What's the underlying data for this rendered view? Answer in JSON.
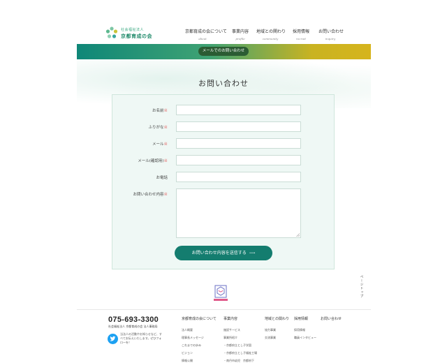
{
  "header": {
    "logo_sub": "社会福祉法人",
    "logo_main": "京都育成の会",
    "nav": [
      {
        "jp": "京都育成の会について",
        "en": "about"
      },
      {
        "jp": "事業内容",
        "en": "profile"
      },
      {
        "jp": "地域との関わり",
        "en": "community"
      },
      {
        "jp": "採用情報",
        "en": "recruit"
      },
      {
        "jp": "お問い合わせ",
        "en": "inquiry"
      }
    ]
  },
  "banner": {
    "button_label": "メールでのお問い合わせ"
  },
  "page_title": "お問い合わせ",
  "form": {
    "fields": [
      {
        "label": "お名前",
        "required": "※"
      },
      {
        "label": "ふりがな",
        "required": "※"
      },
      {
        "label": "メール",
        "required": "※"
      },
      {
        "label": "メール(確認用)",
        "required": "※"
      },
      {
        "label": "お電話",
        "required": ""
      }
    ],
    "message_label": "お問い合わせ内容",
    "message_required": "※",
    "submit_label": "お問い合わせ内容を送信する",
    "submit_arrow": "⟶"
  },
  "page_top": "ページトップ",
  "footer": {
    "phone": "075-693-3300",
    "office": "社会福祉法人 京都育成の会 法人事務局",
    "twitter_text": "当法人の活動やお知らせなど、すべてお伝えいたします。ぜひフォローを！",
    "columns": [
      {
        "head": "京都育成の会について",
        "items": [
          "法人概要",
          "理事長メッセージ",
          "これまでの歩み",
          "ビジョン",
          "情報公開"
        ]
      },
      {
        "head": "事業内容",
        "items": [
          "施設サービス",
          "事業所紹介",
          "・京都府立とし子学園",
          "・京都府立とし子福祉工場",
          "・南丹市幼児　京都府下"
        ]
      },
      {
        "head": "地域との関わり",
        "items": [
          "協力事業",
          "交流事業"
        ]
      },
      {
        "head": "採用情報",
        "items": [
          "採用情報",
          "職員インタビュー"
        ]
      },
      {
        "head": "お問い合わせ",
        "items": []
      }
    ]
  },
  "colors": {
    "teal": "#147d6f",
    "accent_green": "#2b5c33",
    "gold": "#d6b41d",
    "twitter": "#1da1f2"
  }
}
